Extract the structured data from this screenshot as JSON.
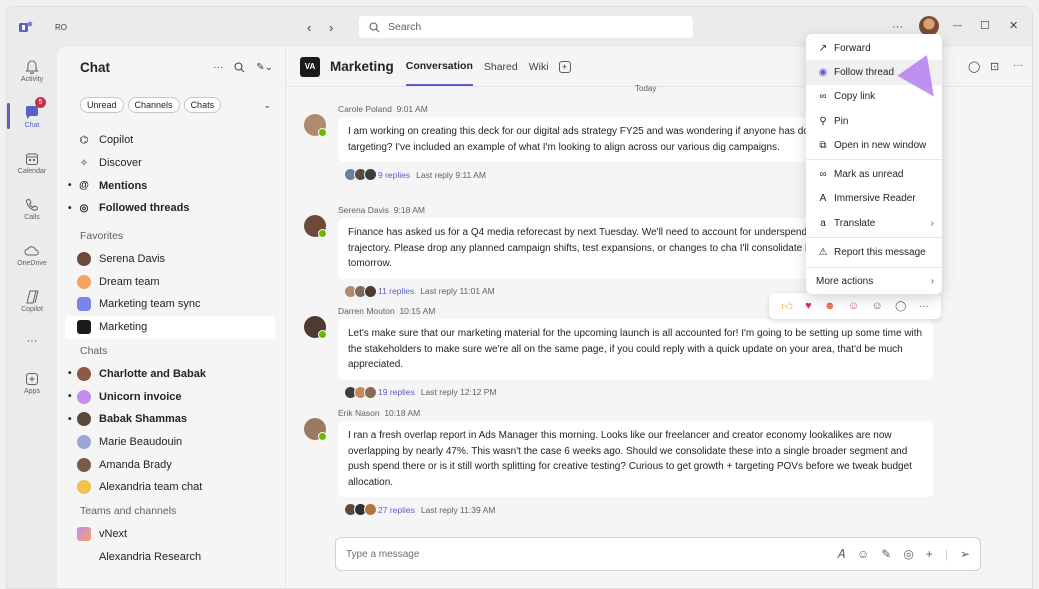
{
  "titlebar": {
    "initials": "RO",
    "search_placeholder": "Search",
    "more": "···",
    "minimize": "—",
    "maximize": "☐",
    "close": "✕"
  },
  "rail": [
    {
      "label": "Activity",
      "icon": "bell-icon"
    },
    {
      "label": "Chat",
      "icon": "chat-icon",
      "badge": "5"
    },
    {
      "label": "Calendar",
      "icon": "calendar-icon"
    },
    {
      "label": "Calls",
      "icon": "phone-icon"
    },
    {
      "label": "OneDrive",
      "icon": "cloud-icon"
    },
    {
      "label": "Copilot",
      "icon": "copilot-icon"
    },
    {
      "label": "···",
      "icon": "more-icon"
    },
    {
      "label": "Apps",
      "icon": "apps-icon"
    }
  ],
  "chat": {
    "title": "Chat",
    "filters": [
      "Unread",
      "Channels",
      "Chats"
    ],
    "items": [
      "Copilot",
      "Discover",
      "Mentions",
      "Followed threads"
    ],
    "favorites_header": "Favorites",
    "favorites": [
      "Serena Davis",
      "Dream team",
      "Marketing team sync",
      "Marketing"
    ],
    "chats_header": "Chats",
    "chats": [
      "Charlotte and Babak",
      "Unicorn invoice",
      "Babak Shammas",
      "Marie Beaudouin",
      "Amanda Brady",
      "Alexandria team chat"
    ],
    "teams_header": "Teams and channels",
    "teams": [
      "vNext",
      "Alexandria Research"
    ]
  },
  "channel": {
    "logo": "VA",
    "name": "Marketing",
    "tabs": [
      "Conversation",
      "Shared",
      "Wiki"
    ],
    "today": "Today"
  },
  "messages": [
    {
      "author": "Carole Poland",
      "time": "9:01 AM",
      "text": "I am working on creating this deck for our digital ads strategy FY25 and was wondering if anyone has do segmentation and targeting? I've included an example of what I'm looking to align across our various dig campaigns.",
      "replies": "9 replies",
      "last": "Last reply 9:11 AM"
    },
    {
      "author": "Serena Davis",
      "time": "9:18 AM",
      "text": "Finance has asked us for a Q4 media reforecast by next Tuesday. We'll need to account for underspend i based on current trajectory. Please drop any planned campaign shifts, test expansions, or changes to cha I'll consolidate into the working doc tomorrow.",
      "replies": "11 replies",
      "last": "Last reply 11:01 AM"
    },
    {
      "author": "Darren Mouton",
      "time": "10:15 AM",
      "text": "Let's make sure that our marketing material for the upcoming launch is all accounted for! I'm going to be setting up some time with the stakeholders to make sure we're all on the same page, if you could reply with a quick update on your area, that'd be much appreciated.",
      "replies": "19 replies",
      "last": "Last reply 12:12 PM"
    },
    {
      "author": "Erik Nason",
      "time": "10:18 AM",
      "text": "I ran a fresh overlap report in Ads Manager this morning. Looks like our freelancer and creator economy lookalikes are now overlapping by nearly 47%. This wasn't the case 6 weeks ago. Should we consolidate these into a single broader segment and push spend there or is it still worth splitting for creative testing? Curious to get growth + targeting POVs before we tweak budget allocation.",
      "replies": "27 replies",
      "last": "Last reply 11:39 AM"
    }
  ],
  "menu": [
    {
      "label": "Forward",
      "icon": "forward-icon"
    },
    {
      "label": "Follow thread",
      "icon": "follow-icon"
    },
    {
      "label": "Copy link",
      "icon": "link-icon"
    },
    {
      "label": "Pin",
      "icon": "pin-icon"
    },
    {
      "label": "Open in new window",
      "icon": "popout-icon"
    },
    {
      "label": "Mark as unread",
      "icon": "unread-icon"
    },
    {
      "label": "Immersive Reader",
      "icon": "reader-icon"
    },
    {
      "label": "Translate",
      "icon": "translate-icon"
    },
    {
      "label": "Report this message",
      "icon": "report-icon"
    },
    {
      "label": "More actions",
      "icon": "more-actions-icon"
    }
  ],
  "compose": {
    "placeholder": "Type a message"
  },
  "colors": {
    "accent": "#5b5fc7",
    "badge": "#c4314b",
    "presence": "#6bb700"
  }
}
